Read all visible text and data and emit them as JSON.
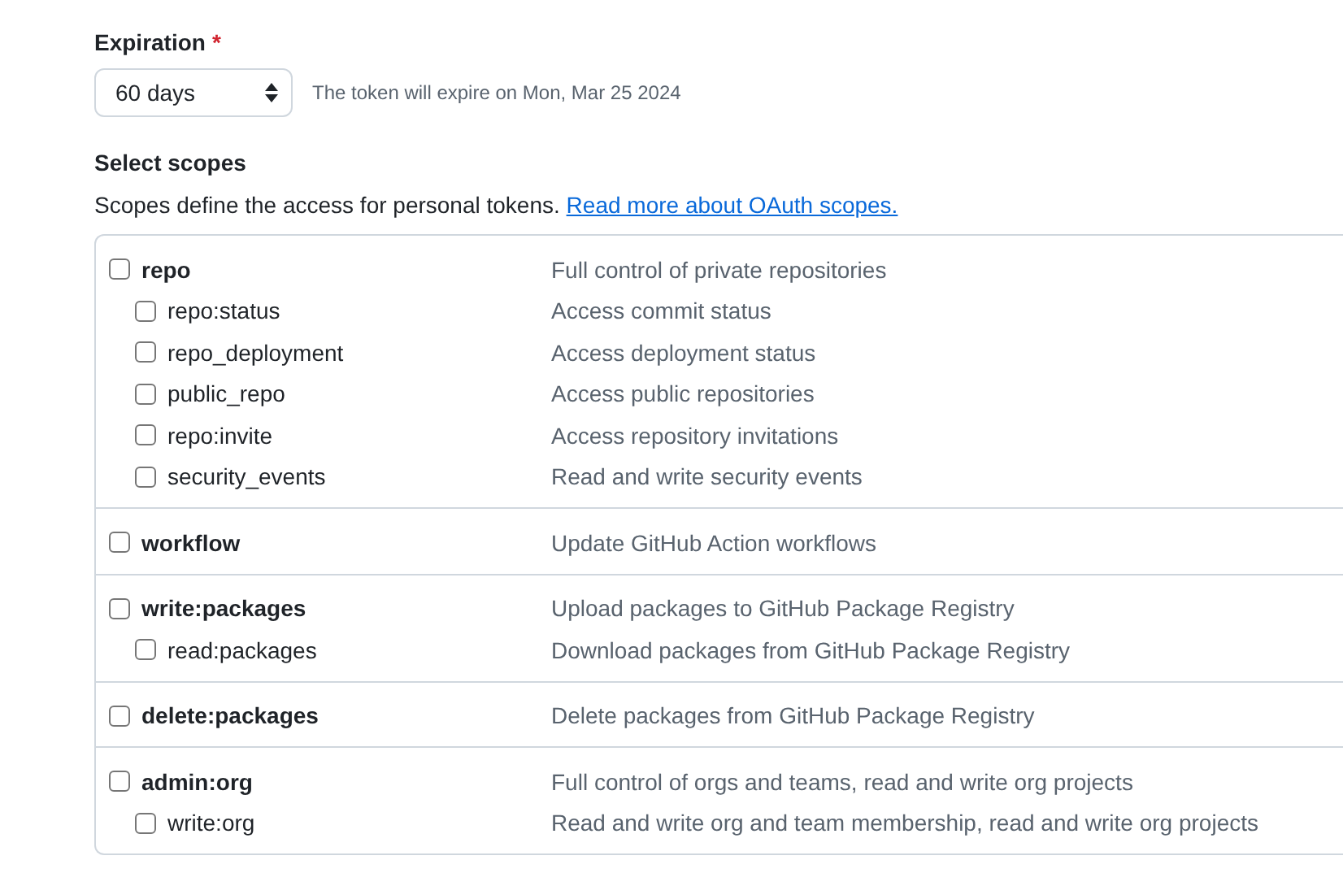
{
  "expiration": {
    "label": "Expiration",
    "required_mark": "*",
    "select_value": "60 days",
    "note": "The token will expire on Mon, Mar 25 2024"
  },
  "scopes": {
    "heading": "Select scopes",
    "description": "Scopes define the access for personal tokens.",
    "link": "Read more about OAuth scopes.",
    "groups": [
      {
        "name": "repo",
        "description": "Full control of private repositories",
        "checked": false,
        "children": [
          {
            "name": "repo:status",
            "description": "Access commit status",
            "checked": false
          },
          {
            "name": "repo_deployment",
            "description": "Access deployment status",
            "checked": false
          },
          {
            "name": "public_repo",
            "description": "Access public repositories",
            "checked": false
          },
          {
            "name": "repo:invite",
            "description": "Access repository invitations",
            "checked": false
          },
          {
            "name": "security_events",
            "description": "Read and write security events",
            "checked": false
          }
        ]
      },
      {
        "name": "workflow",
        "description": "Update GitHub Action workflows",
        "checked": false
      },
      {
        "name": "write:packages",
        "description": "Upload packages to GitHub Package Registry",
        "checked": false,
        "children": [
          {
            "name": "read:packages",
            "description": "Download packages from GitHub Package Registry",
            "checked": false
          }
        ]
      },
      {
        "name": "delete:packages",
        "description": "Delete packages from GitHub Package Registry",
        "checked": false
      },
      {
        "name": "admin:org",
        "description": "Full control of orgs and teams, read and write org projects",
        "checked": false,
        "children": [
          {
            "name": "write:org",
            "description": "Read and write org and team membership, read and write org projects",
            "checked": false
          }
        ]
      }
    ]
  }
}
